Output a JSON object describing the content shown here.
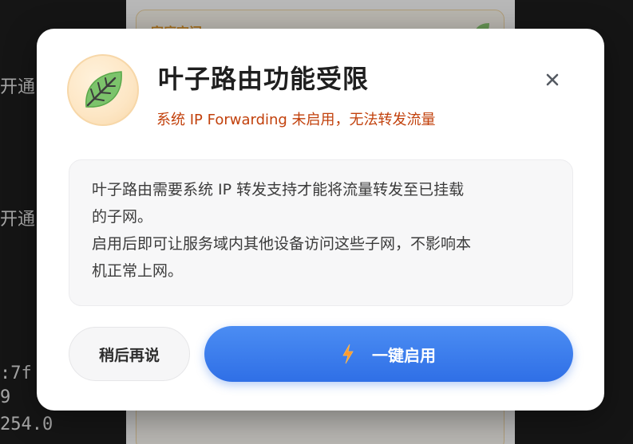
{
  "terminal": {
    "lines": [
      "开通",
      "开通",
      ":7f",
      "9",
      "254.0"
    ]
  },
  "background_card": {
    "title": "家庭空间"
  },
  "dialog": {
    "title": "叶子路由功能受限",
    "subtitle": "系统 IP Forwarding 未启用，无法转发流量",
    "description_lines": [
      "叶子路由需要系统 IP 转发支持才能将流量转发至已挂载",
      "的子网。",
      "启用后即可让服务域内其他设备访问这些子网，不影响本",
      "机正常上网。"
    ],
    "later_button": "稍后再说",
    "enable_button": "一键启用",
    "icons": {
      "badge": "leaf-icon",
      "close": "close-icon",
      "enable": "lightning-icon"
    },
    "colors": {
      "subtitle": "#c2410c",
      "primary": "#3b7bef",
      "badge_bg": "#fde6c4",
      "leaf": "#7cc36b"
    }
  }
}
